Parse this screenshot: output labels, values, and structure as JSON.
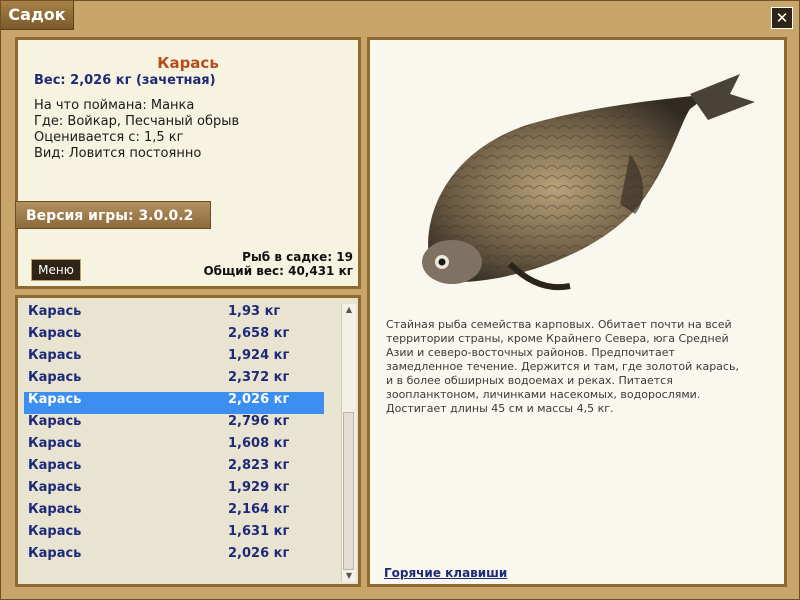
{
  "window": {
    "title": "Садок",
    "close_label": "✕"
  },
  "fish": {
    "name": "Карась",
    "weight": "Вес: 2,026 кг (зачетная)",
    "bait": "На что поймана: Манка",
    "location": "Где: Войкар, Песчаный обрыв",
    "rated_from": "Оценивается с: 1,5 кг",
    "species_type": "Вид: Ловится постоянно"
  },
  "version": "Версия игры: 3.0.0.2",
  "menu_label": "Меню",
  "stats": {
    "count": "Рыб в садке: 19",
    "total_weight": "Общий вес: 40,431 кг"
  },
  "catch_list": [
    {
      "name": "Карась",
      "weight": "1,93 кг"
    },
    {
      "name": "Карась",
      "weight": "2,658 кг"
    },
    {
      "name": "Карась",
      "weight": "1,924 кг"
    },
    {
      "name": "Карась",
      "weight": "2,372 кг"
    },
    {
      "name": "Карась",
      "weight": "2,026 кг",
      "selected": true
    },
    {
      "name": "Карась",
      "weight": "2,796 кг"
    },
    {
      "name": "Карась",
      "weight": "1,608 кг"
    },
    {
      "name": "Карась",
      "weight": "2,823 кг"
    },
    {
      "name": "Карась",
      "weight": "1,929 кг"
    },
    {
      "name": "Карась",
      "weight": "2,164 кг"
    },
    {
      "name": "Карась",
      "weight": "1,631 кг"
    },
    {
      "name": "Карась",
      "weight": "2,026 кг"
    }
  ],
  "description": "Стайная рыба семейства карповых. Обитает почти на всей территории страны, кроме Крайнего Севера, юга Средней Азии и северо-восточных районов. Предпочитает замедленное течение. Держится и там, где золотой карась, и в более обширных водоемах и реках. Питается зоопланктоном, личинками насекомых, водорослями. Достигает длины 45 см и массы 4,5 кг.",
  "hotkeys_label": "Горячие клавиши",
  "icons": {
    "close": "close-icon",
    "scroll_up": "arrow-up-icon",
    "scroll_down": "arrow-down-icon"
  },
  "colors": {
    "accent": "#3c8ff0",
    "name_color": "#b54e1e",
    "link": "#1e2a78"
  }
}
